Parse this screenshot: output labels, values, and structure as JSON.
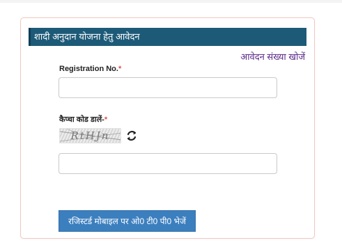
{
  "form": {
    "title": "शादी अनुदान योजना हेतु आवेदन",
    "search_link": "आवेदन संख्या खोजें",
    "registration": {
      "label": "Registration No.",
      "required_mark": "*",
      "value": ""
    },
    "captcha": {
      "label": "कैप्चा कोड डालें-",
      "required_mark": "*",
      "code": "RtHJn",
      "value": "",
      "refresh_icon": "refresh-icon"
    },
    "submit_label": "रजिस्टर्ड मोबाइल पर ओ0 टी0 पी0 भेजें"
  },
  "colors": {
    "header_bg": "#1d5a78",
    "link": "#5a2a88",
    "button_bg": "#3c7fbf",
    "card_border": "#f2c6c0",
    "required": "#d9534f"
  }
}
